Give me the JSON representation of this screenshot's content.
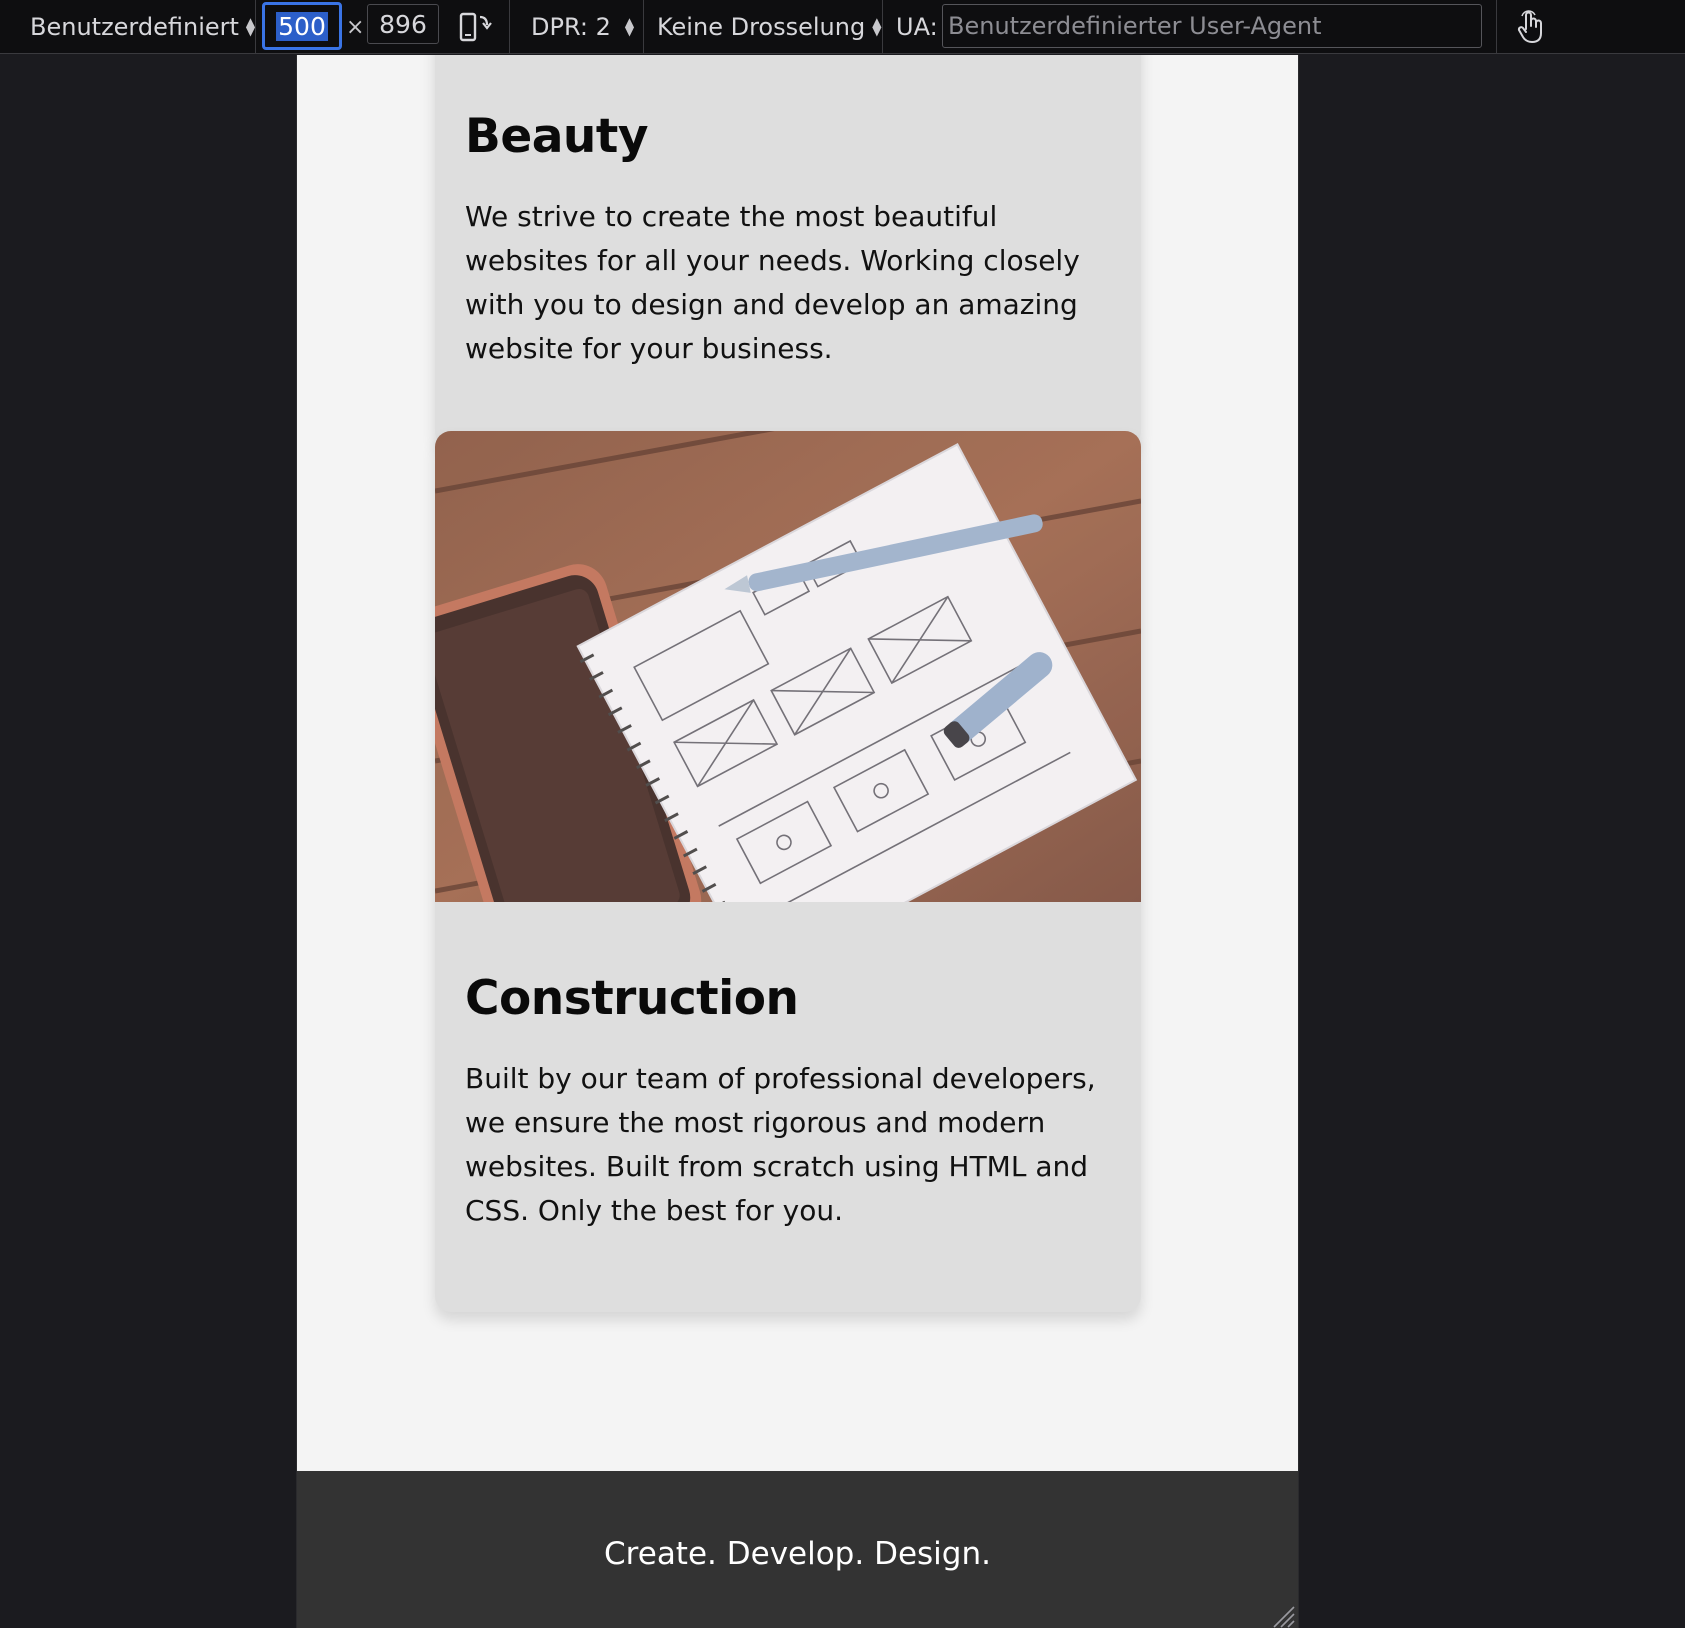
{
  "toolbar": {
    "device_label": "Benutzerdefiniert",
    "width_value": "500",
    "times_symbol": "×",
    "height_value": "896",
    "dpr_label": "DPR: 2",
    "throttle_label": "Keine Drosselung",
    "ua_label": "UA:",
    "ua_placeholder": "Benutzerdefinierter User-Agent",
    "rotate_icon": "rotate-device-icon",
    "touch_icon": "touch-simulation-icon"
  },
  "cards": [
    {
      "title": "Beauty",
      "text": "We strive to create the most beautiful websites for all your needs. Working closely with you to design and develop an amazing website for your business."
    },
    {
      "image": "wireframe-notebook-photo",
      "title": "Construction",
      "text": "Built by our team of professional developers, we ensure the most rigorous and modern websites. Built from scratch using HTML and CSS. Only the best for you."
    }
  ],
  "footer": {
    "tagline": "Create. Develop. Design."
  },
  "colors": {
    "toolbar_bg": "#0e0e10",
    "focus_ring": "#3a74e6",
    "page_bg": "#f4f4f4",
    "card_bg": "#dedede",
    "footer_bg": "#333333"
  }
}
